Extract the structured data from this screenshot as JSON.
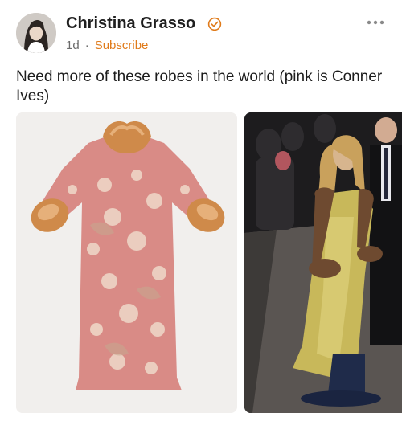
{
  "post": {
    "author": "Christina Grasso",
    "time": "1d",
    "separator": "·",
    "subscribe_label": "Subscribe",
    "text": "Need more of these robes in the world (pink is Conner Ives)"
  },
  "icons": {
    "verified": "verified-badge-icon",
    "more": "more-options-icon"
  },
  "colors": {
    "accent": "#e07b1b",
    "text": "#1f1f1f",
    "meta": "#6b6b6b"
  }
}
